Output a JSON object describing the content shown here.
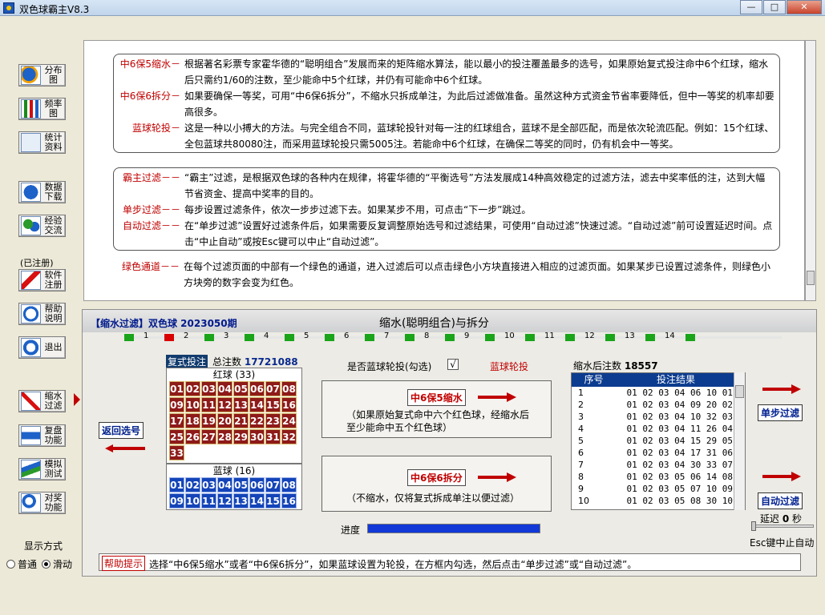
{
  "window": {
    "title": "双色球霸主V8.3",
    "btn_min": "—",
    "btn_max": "□",
    "btn_close": "✕"
  },
  "sidebar": {
    "tools": [
      {
        "label": "分布图",
        "icon": "pie-chart-icon"
      },
      {
        "label": "频率图",
        "icon": "bar-chart-icon"
      },
      {
        "label": "统计资料",
        "icon": "statistics-icon"
      },
      {
        "label": "数据下载",
        "icon": "download-icon"
      },
      {
        "label": "经验交流",
        "icon": "users-icon"
      },
      {
        "label": "软件注册",
        "icon": "key-icon"
      },
      {
        "label": "帮助说明",
        "icon": "help-icon"
      },
      {
        "label": "退出",
        "icon": "exit-icon"
      },
      {
        "label": "缩水过滤",
        "icon": "filter-icon"
      },
      {
        "label": "复盘功能",
        "icon": "replay-icon"
      },
      {
        "label": "模拟测试",
        "icon": "simulate-icon"
      },
      {
        "label": "对奖功能",
        "icon": "prize-check-icon"
      }
    ],
    "registered": "(已注册)",
    "display_mode_label": "显示方式",
    "mode_normal": "普通",
    "mode_scroll": "滑动"
  },
  "info": {
    "box1": [
      {
        "key": "中6保5缩水－",
        "text": "根据著名彩票专家霍华德的“聪明组合”发展而来的矩阵缩水算法，能以最小的投注覆盖最多的选号，如果原始复式投注命中6个红球，缩水后只需约1/60的注数，至少能命中5个红球，并仍有可能命中6个红球。"
      },
      {
        "key": "中6保6拆分－",
        "text": "如果要确保一等奖，可用“中6保6拆分”，不缩水只拆成单注，为此后过滤做准备。虽然这种方式资金节省率要降低，但中一等奖的机率却要高很多。"
      },
      {
        "key": "蓝球轮投－",
        "text": "这是一种以小搏大的方法。与完全组合不同，蓝球轮投针对每一注的红球组合，蓝球不是全部匹配，而是依次轮流匹配。例如：15个红球、全包蓝球共80080注，而采用蓝球轮投只需5005注。若能命中6个红球，在确保二等奖的同时，仍有机会中一等奖。"
      }
    ],
    "box2": [
      {
        "key": "霸主过滤－－",
        "text": "“霸主”过滤，是根据双色球的各种内在规律，将霍华德的“平衡选号”方法发展成14种高效稳定的过滤方法，滤去中奖率低的注，达到大幅节省资金、提高中奖率的目的。"
      },
      {
        "key": "单步过滤－－",
        "text": "每步设置过滤条件，依次一步步过滤下去。如果某步不用，可点击“下一步”跳过。"
      },
      {
        "key": "自动过滤－－",
        "text": "在“单步过滤”设置好过滤条件后，如果需要反复调整原始选号和过滤结果，可使用“自动过滤”快速过滤。“自动过滤”前可设置延迟时间。点击“中止自动”或按Esc键可以中止“自动过滤”。"
      }
    ],
    "green": {
      "key": "绿色通道－－",
      "text": "在每个过滤页面的中部有一个绿色的通道，进入过滤后可以点击绿色小方块直接进入相应的过滤页面。如果某步已设置过滤条件，则绿色小方块旁的数字会变为红色。"
    }
  },
  "filter": {
    "header_left": "【缩水过滤】双色球 2023050期",
    "header_title": "缩水(聪明组合)与拆分",
    "steps": [
      "1",
      "2",
      "3",
      "4",
      "5",
      "6",
      "7",
      "8",
      "9",
      "10",
      "11",
      "12",
      "13",
      "14"
    ],
    "fushi_tag": "复式投注",
    "total_label": "总注数",
    "total_value": "17721088",
    "red_title": "红球 (33)",
    "red_numbers": [
      "01",
      "02",
      "03",
      "04",
      "05",
      "06",
      "07",
      "08",
      "09",
      "10",
      "11",
      "12",
      "13",
      "14",
      "15",
      "16",
      "17",
      "18",
      "19",
      "20",
      "21",
      "22",
      "23",
      "24",
      "25",
      "26",
      "27",
      "28",
      "29",
      "30",
      "31",
      "32",
      "33"
    ],
    "blue_title": "蓝球 (16)",
    "blue_numbers": [
      "01",
      "02",
      "03",
      "04",
      "05",
      "06",
      "07",
      "08",
      "09",
      "10",
      "11",
      "12",
      "13",
      "14",
      "15",
      "16"
    ],
    "return_btn": "返回选号",
    "blue_rotation_question": "是否蓝球轮投(勾选)",
    "checkbox_mark": "√",
    "blue_rotation_label": "蓝球轮投",
    "btn_6b5": "中6保5缩水",
    "note_6b5": "（如果原始复式命中六个红色球，经缩水后至少能命中五个红色球）",
    "btn_6b6": "中6保6拆分",
    "note_6b6": "（不缩水，仅将复式拆成单注以便过滤）",
    "after_label": "缩水后注数",
    "after_value": "18557",
    "col_seq": "序号",
    "col_result": "投注结果",
    "rows": [
      [
        "1",
        "01 02 03 04 06 10 01"
      ],
      [
        "2",
        "01 02 03 04 09 20 02"
      ],
      [
        "3",
        "01 02 03 04 10 32 03"
      ],
      [
        "4",
        "01 02 03 04 11 26 04"
      ],
      [
        "5",
        "01 02 03 04 15 29 05"
      ],
      [
        "6",
        "01 02 03 04 17 31 06"
      ],
      [
        "7",
        "01 02 03 04 30 33 07"
      ],
      [
        "8",
        "01 02 03 05 06 14 08"
      ],
      [
        "9",
        "01 02 03 05 07 10 09"
      ],
      [
        "10",
        "01 02 03 05 08 30 10"
      ]
    ],
    "single_step": "单步过滤",
    "auto_filter": "自动过滤",
    "delay_prefix": "延迟",
    "delay_value": "0",
    "delay_unit": "秒",
    "esc_note": "Esc键中止自动",
    "progress_label": "进度",
    "progress_value": 1.0,
    "help_tag": "帮助提示",
    "help_text": "选择“中6保5缩水”或者“中6保6拆分”，如果蓝球设置为轮投，在方框内勾选，然后点击“单步过滤”或“自动过滤”。"
  },
  "colors": {
    "accent_red": "#c00000",
    "navy": "#0c3c8f",
    "step_green": "#1aa41a",
    "red_ball": "#8e1a1a",
    "blue_ball": "#1444b8",
    "progress": "#1238d8"
  }
}
